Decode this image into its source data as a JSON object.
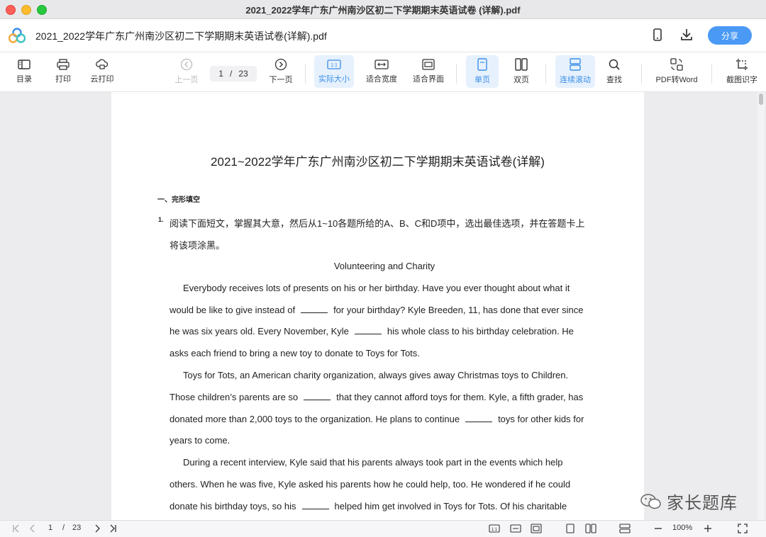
{
  "window": {
    "title": "2021_2022学年广东广州南沙区初二下学期期末英语试卷 (详解).pdf"
  },
  "appbar": {
    "doc_title": "2021_2022学年广东广州南沙区初二下学期期末英语试卷(详解).pdf",
    "share_label": "分享"
  },
  "toolbar": {
    "toc": "目录",
    "print": "打印",
    "cloud_print": "云打印",
    "prev": "上一页",
    "page_current": "1",
    "page_sep": "/",
    "page_total": "23",
    "next": "下一页",
    "actual_size": "实际大小",
    "fit_width": "适合宽度",
    "fit_window": "适合界面",
    "single_page": "单页",
    "double_page": "双页",
    "continuous": "连续滚动",
    "find": "查找",
    "pdf_to_word": "PDF转Word",
    "ocr": "截图识字"
  },
  "document": {
    "heading": "2021~2022学年广东广州南沙区初二下学期期末英语试卷(详解)",
    "section": "一、完形填空",
    "qnum": "1.",
    "instr1": "阅读下面短文，掌握其大意，然后从1~10各题所给的A、B、C和D项中，选出最佳选项，并在答题卡上",
    "instr2": "将该项涂黑。",
    "passage_title": "Volunteering and Charity",
    "l1": "Everybody receives lots of presents on his or her birthday. Have you ever thought about what it",
    "l2a": "would be like to give instead of",
    "l2b": "for your birthday? Kyle Breeden, 11, has done that ever since",
    "l3a": "he was six years old. Every November, Kyle",
    "l3b": "his whole class to his birthday celebration. He",
    "l4": "asks each friend to bring a new toy to donate to Toys for Tots.",
    "l5": "Toys for Tots, an American charity organization, always gives away Christmas toys to Children.",
    "l6a": "Those children’s parents are so",
    "l6b": "that they cannot afford toys for them. Kyle, a fifth grader, has",
    "l7a": "donated more than 2,000 toys to the organization. He plans to continue",
    "l7b": "toys for other kids for",
    "l8": "years to come.",
    "l9": "During a recent interview, Kyle said that his parents always took part in the events which help",
    "l10": "others. When he was five, Kyle asked his parents how he could help, too. He wondered if he could",
    "l11a": "donate his birthday toys, so his",
    "l11b": "helped him get involved in Toys for Tots. Of his charitable"
  },
  "statusbar": {
    "page_current": "1",
    "page_sep": "/",
    "page_total": "23",
    "zoom": "100%"
  },
  "watermark": {
    "text": "家长题库"
  }
}
